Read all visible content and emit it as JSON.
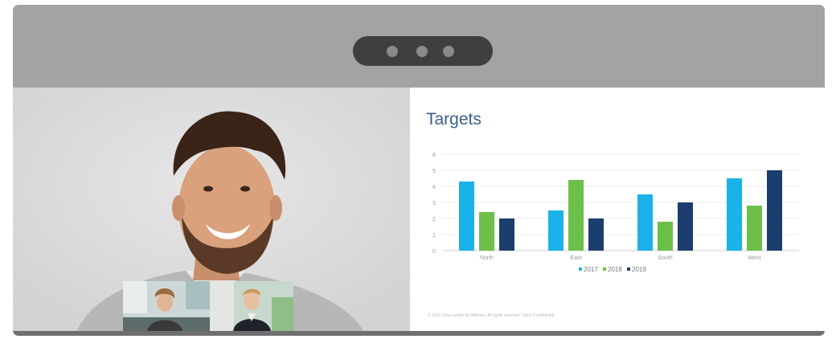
{
  "slide": {
    "title": "Targets",
    "footer": "© 2016 Cisco and/or its affiliates. All rights reserved.   Cisco Confidential"
  },
  "colors": {
    "bezel": "#a3a3a3",
    "camera_bar": "#3f3f3f",
    "series_2017": "#1ab2e8",
    "series_2018": "#6cc04a",
    "series_2019": "#1c3e6e"
  },
  "chart_data": {
    "type": "bar",
    "title": "Targets",
    "categories": [
      "North",
      "East",
      "South",
      "West"
    ],
    "series": [
      {
        "name": "2017",
        "color": "#1ab2e8",
        "values": [
          4.3,
          2.5,
          3.5,
          4.5
        ]
      },
      {
        "name": "2018",
        "color": "#6cc04a",
        "values": [
          2.4,
          4.4,
          1.8,
          2.8
        ]
      },
      {
        "name": "2019",
        "color": "#1c3e6e",
        "values": [
          2.0,
          2.0,
          3.0,
          5.0
        ]
      }
    ],
    "yticks": [
      "0",
      "1",
      "2",
      "3",
      "4",
      "5",
      "6"
    ],
    "ylim": [
      0,
      6
    ],
    "grid": true,
    "legend": "bottom-center"
  }
}
